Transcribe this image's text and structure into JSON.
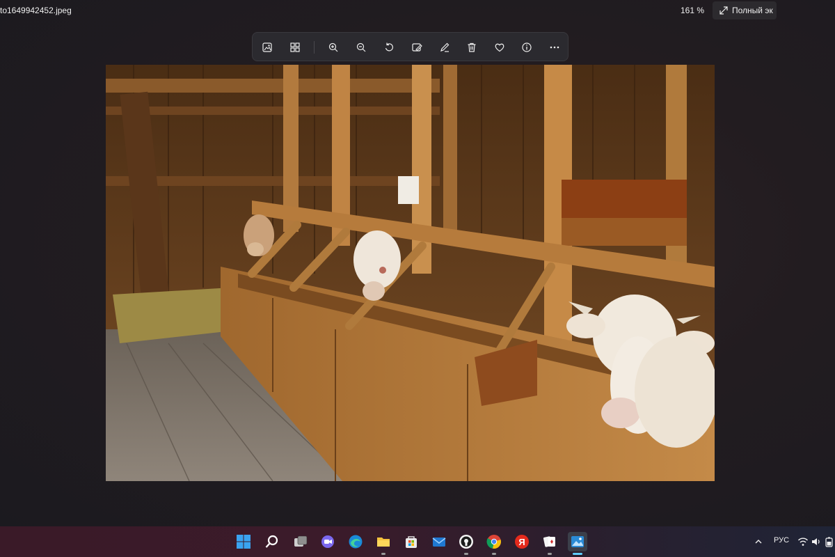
{
  "window": {
    "title": "to1649942452.jpeg",
    "zoom": "161 %",
    "fullscreen_label": "Полный эк"
  },
  "toolbar": {
    "items": [
      {
        "icon": "image-icon"
      },
      {
        "icon": "gallery-grid-icon"
      },
      {
        "icon": "zoom-in-icon"
      },
      {
        "icon": "zoom-out-icon"
      },
      {
        "icon": "rotate-icon"
      },
      {
        "icon": "edit-image-icon"
      },
      {
        "icon": "draw-pen-icon"
      },
      {
        "icon": "delete-icon"
      },
      {
        "icon": "favorite-heart-icon"
      },
      {
        "icon": "info-icon"
      },
      {
        "icon": "more-options-icon"
      }
    ]
  },
  "taskbar": {
    "apps": [
      {
        "icon": "windows-start-icon"
      },
      {
        "icon": "search-icon"
      },
      {
        "icon": "task-view-icon"
      },
      {
        "icon": "chat-icon"
      },
      {
        "icon": "edge-browser-icon"
      },
      {
        "icon": "file-explorer-icon"
      },
      {
        "icon": "store-icon"
      },
      {
        "icon": "mail-icon"
      },
      {
        "icon": "steam-icon"
      },
      {
        "icon": "chrome-icon"
      },
      {
        "icon": "yandex-browser-icon"
      },
      {
        "icon": "solitaire-icon"
      },
      {
        "icon": "photos-app-icon"
      }
    ],
    "tray": {
      "language": "РУС"
    }
  }
}
